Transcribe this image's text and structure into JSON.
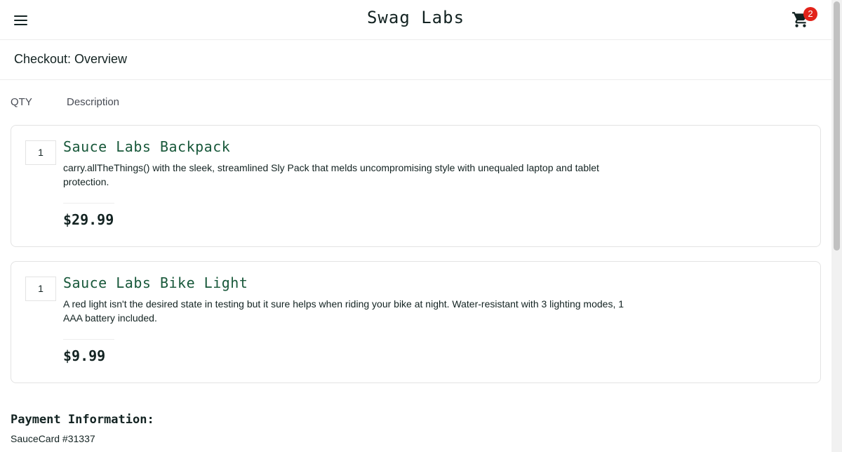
{
  "header": {
    "logo": "Swag Labs",
    "cart_badge": "2",
    "badge_color": "#e2231a"
  },
  "subheader": {
    "title": "Checkout: Overview"
  },
  "columns": {
    "qty": "QTY",
    "description": "Description"
  },
  "items": [
    {
      "qty": "1",
      "name": "Sauce Labs Backpack",
      "description": "carry.allTheThings() with the sleek, streamlined Sly Pack that melds uncompromising style with unequaled laptop and tablet protection.",
      "price": "$29.99"
    },
    {
      "qty": "1",
      "name": "Sauce Labs Bike Light",
      "description": "A red light isn't the desired state in testing but it sure helps when riding your bike at night. Water-resistant with 3 lighting modes, 1 AAA battery included.",
      "price": "$9.99"
    }
  ],
  "payment": {
    "label": "Payment Information:",
    "value": "SauceCard #31337"
  },
  "colors": {
    "item_name": "#18583a",
    "text": "#132322",
    "border": "#e3e3e3"
  }
}
